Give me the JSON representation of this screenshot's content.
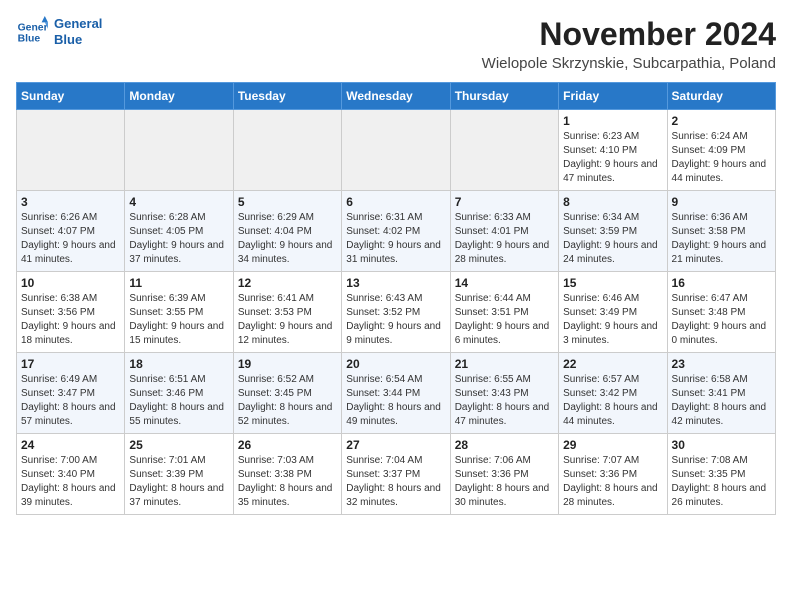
{
  "header": {
    "logo_line1": "General",
    "logo_line2": "Blue",
    "month_title": "November 2024",
    "location": "Wielopole Skrzynskie, Subcarpathia, Poland"
  },
  "weekdays": [
    "Sunday",
    "Monday",
    "Tuesday",
    "Wednesday",
    "Thursday",
    "Friday",
    "Saturday"
  ],
  "weeks": [
    [
      {
        "day": "",
        "info": ""
      },
      {
        "day": "",
        "info": ""
      },
      {
        "day": "",
        "info": ""
      },
      {
        "day": "",
        "info": ""
      },
      {
        "day": "",
        "info": ""
      },
      {
        "day": "1",
        "info": "Sunrise: 6:23 AM\nSunset: 4:10 PM\nDaylight: 9 hours and 47 minutes."
      },
      {
        "day": "2",
        "info": "Sunrise: 6:24 AM\nSunset: 4:09 PM\nDaylight: 9 hours and 44 minutes."
      }
    ],
    [
      {
        "day": "3",
        "info": "Sunrise: 6:26 AM\nSunset: 4:07 PM\nDaylight: 9 hours and 41 minutes."
      },
      {
        "day": "4",
        "info": "Sunrise: 6:28 AM\nSunset: 4:05 PM\nDaylight: 9 hours and 37 minutes."
      },
      {
        "day": "5",
        "info": "Sunrise: 6:29 AM\nSunset: 4:04 PM\nDaylight: 9 hours and 34 minutes."
      },
      {
        "day": "6",
        "info": "Sunrise: 6:31 AM\nSunset: 4:02 PM\nDaylight: 9 hours and 31 minutes."
      },
      {
        "day": "7",
        "info": "Sunrise: 6:33 AM\nSunset: 4:01 PM\nDaylight: 9 hours and 28 minutes."
      },
      {
        "day": "8",
        "info": "Sunrise: 6:34 AM\nSunset: 3:59 PM\nDaylight: 9 hours and 24 minutes."
      },
      {
        "day": "9",
        "info": "Sunrise: 6:36 AM\nSunset: 3:58 PM\nDaylight: 9 hours and 21 minutes."
      }
    ],
    [
      {
        "day": "10",
        "info": "Sunrise: 6:38 AM\nSunset: 3:56 PM\nDaylight: 9 hours and 18 minutes."
      },
      {
        "day": "11",
        "info": "Sunrise: 6:39 AM\nSunset: 3:55 PM\nDaylight: 9 hours and 15 minutes."
      },
      {
        "day": "12",
        "info": "Sunrise: 6:41 AM\nSunset: 3:53 PM\nDaylight: 9 hours and 12 minutes."
      },
      {
        "day": "13",
        "info": "Sunrise: 6:43 AM\nSunset: 3:52 PM\nDaylight: 9 hours and 9 minutes."
      },
      {
        "day": "14",
        "info": "Sunrise: 6:44 AM\nSunset: 3:51 PM\nDaylight: 9 hours and 6 minutes."
      },
      {
        "day": "15",
        "info": "Sunrise: 6:46 AM\nSunset: 3:49 PM\nDaylight: 9 hours and 3 minutes."
      },
      {
        "day": "16",
        "info": "Sunrise: 6:47 AM\nSunset: 3:48 PM\nDaylight: 9 hours and 0 minutes."
      }
    ],
    [
      {
        "day": "17",
        "info": "Sunrise: 6:49 AM\nSunset: 3:47 PM\nDaylight: 8 hours and 57 minutes."
      },
      {
        "day": "18",
        "info": "Sunrise: 6:51 AM\nSunset: 3:46 PM\nDaylight: 8 hours and 55 minutes."
      },
      {
        "day": "19",
        "info": "Sunrise: 6:52 AM\nSunset: 3:45 PM\nDaylight: 8 hours and 52 minutes."
      },
      {
        "day": "20",
        "info": "Sunrise: 6:54 AM\nSunset: 3:44 PM\nDaylight: 8 hours and 49 minutes."
      },
      {
        "day": "21",
        "info": "Sunrise: 6:55 AM\nSunset: 3:43 PM\nDaylight: 8 hours and 47 minutes."
      },
      {
        "day": "22",
        "info": "Sunrise: 6:57 AM\nSunset: 3:42 PM\nDaylight: 8 hours and 44 minutes."
      },
      {
        "day": "23",
        "info": "Sunrise: 6:58 AM\nSunset: 3:41 PM\nDaylight: 8 hours and 42 minutes."
      }
    ],
    [
      {
        "day": "24",
        "info": "Sunrise: 7:00 AM\nSunset: 3:40 PM\nDaylight: 8 hours and 39 minutes."
      },
      {
        "day": "25",
        "info": "Sunrise: 7:01 AM\nSunset: 3:39 PM\nDaylight: 8 hours and 37 minutes."
      },
      {
        "day": "26",
        "info": "Sunrise: 7:03 AM\nSunset: 3:38 PM\nDaylight: 8 hours and 35 minutes."
      },
      {
        "day": "27",
        "info": "Sunrise: 7:04 AM\nSunset: 3:37 PM\nDaylight: 8 hours and 32 minutes."
      },
      {
        "day": "28",
        "info": "Sunrise: 7:06 AM\nSunset: 3:36 PM\nDaylight: 8 hours and 30 minutes."
      },
      {
        "day": "29",
        "info": "Sunrise: 7:07 AM\nSunset: 3:36 PM\nDaylight: 8 hours and 28 minutes."
      },
      {
        "day": "30",
        "info": "Sunrise: 7:08 AM\nSunset: 3:35 PM\nDaylight: 8 hours and 26 minutes."
      }
    ]
  ]
}
